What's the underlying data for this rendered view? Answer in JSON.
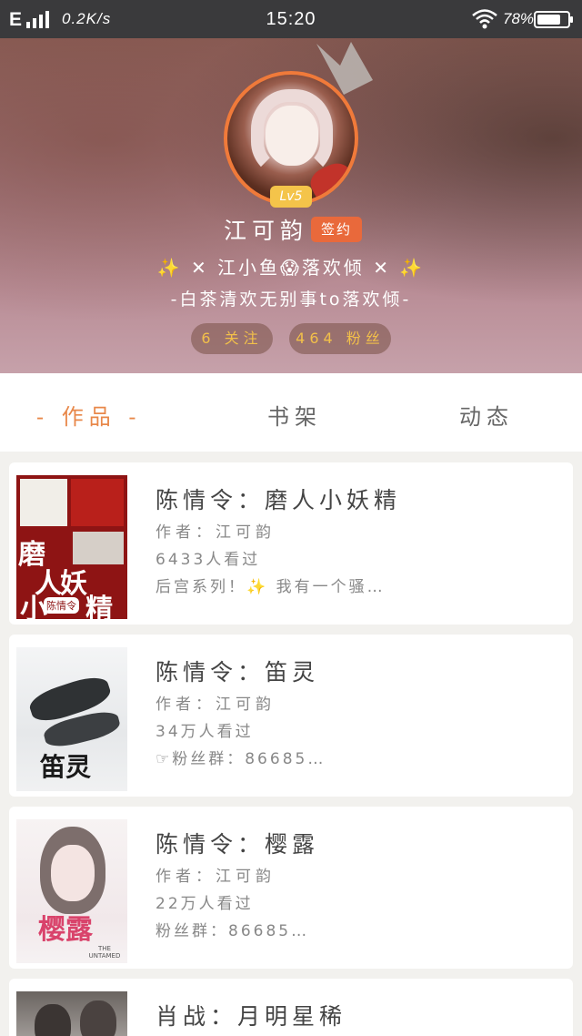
{
  "status_bar": {
    "network": "E",
    "speed": "0.2K/s",
    "time": "15:20",
    "battery": "78%",
    "battery_level": 0.78
  },
  "profile": {
    "level": "Lv5",
    "name": "江可韵",
    "sign_tag": "签约",
    "bio_line1": "✨ ✕ 江小鱼😱落欢倾 ✕ ✨",
    "bio_line2": "-白茶清欢无别事to落欢倾-",
    "follow": "6 关注",
    "fans": "464 粉丝"
  },
  "tabs": [
    {
      "label": "- 作品 -",
      "active": true
    },
    {
      "label": "书架",
      "active": false
    },
    {
      "label": "动态",
      "active": false
    }
  ],
  "books": [
    {
      "title": "陈情令：磨人小妖精",
      "author": "作者：江可韵",
      "views": "6433人看过",
      "desc": "后宫系列！✨ 我有一个骚…",
      "cover_text": [
        "磨",
        "人",
        "妖",
        "小",
        "精",
        "陈情令"
      ]
    },
    {
      "title": "陈情令：笛灵",
      "author": "作者：江可韵",
      "views": "34万人看过",
      "desc": "☞粉丝群：86685…",
      "cover_text": [
        "笛灵"
      ]
    },
    {
      "title": "陈情令：樱露",
      "author": "作者：江可韵",
      "views": "22万人看过",
      "desc": "粉丝群：86685…",
      "cover_text": [
        "樱露",
        "THE UNTAMED"
      ]
    },
    {
      "title": "肖战：月明星稀",
      "author": "",
      "views": "",
      "desc": "",
      "cover_text": []
    }
  ],
  "colors": {
    "accent": "#e8884a",
    "sign_tag": "#e9693b",
    "level_badge": "#f4c44a",
    "pill_text": "#f2c04a",
    "status_bar": "#3a3a3c"
  }
}
